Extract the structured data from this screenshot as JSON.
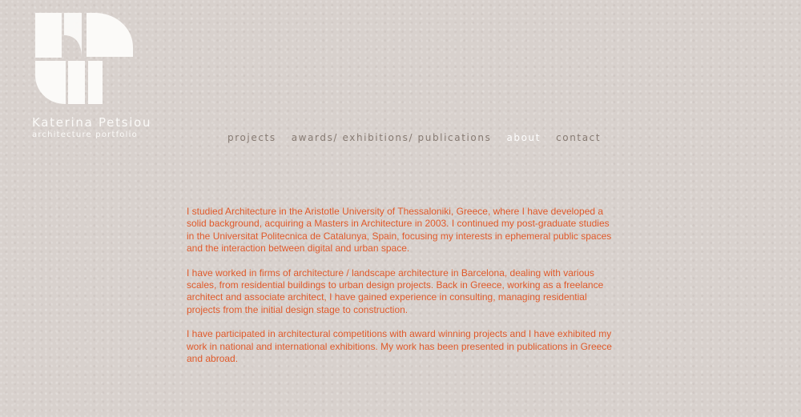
{
  "brand": {
    "name": "Katerina Petsiou",
    "subtitle": "architecture portfolio",
    "logo_icon": "kp-monogram-icon"
  },
  "nav": {
    "items": [
      {
        "label": "projects",
        "active": false
      },
      {
        "label": "awards/ exhibitions/ publications",
        "active": false
      },
      {
        "label": "about",
        "active": true
      },
      {
        "label": "contact",
        "active": false
      }
    ]
  },
  "about": {
    "paragraphs": [
      "I studied Architecture in the Aristotle University of Thessaloniki, Greece, where I have developed a solid background, acquiring a Masters in Architecture in 2003. I continued my post-graduate studies in the Universitat Politecnica de Catalunya, Spain, focusing my interests in ephemeral public spaces and the interaction between digital and urban space.",
      "I have worked in firms of architecture / landscape architecture in Barcelona, dealing with various scales, from residential buildings to urban design projects.  Back in Greece, working as a freelance architect and associate architect, I have gained experience in consulting, managing residential projects from the initial design stage to construction.",
      "I have participated in architectural competitions with award winning projects and I have exhibited my work in national and international exhibitions. My work has been presented in publications in Greece and abroad."
    ]
  },
  "colors": {
    "background": "#d8d1cd",
    "nav_text": "#867a72",
    "nav_active": "#ffffff",
    "body_text": "#e05a2b",
    "logo": "#fbfaf8"
  }
}
